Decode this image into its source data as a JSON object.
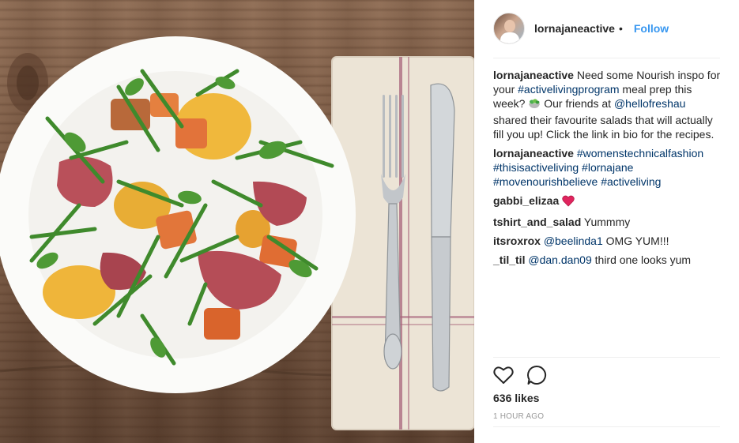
{
  "post": {
    "username": "lornajaneactive",
    "separator": "•",
    "follow_label": "Follow",
    "caption": {
      "username": "lornajaneactive",
      "text1": "Need some Nourish inspo for your",
      "hashtag": "#activelivingprogram",
      "text2": "meal prep this week?",
      "emoji_icon": "salad-bowl-emoji",
      "text3": "Our friends at",
      "mention": "@hellofreshau",
      "text4": "shared their favourite salads that will actually fill you up! Click the link in bio for the recipes."
    },
    "comments": [
      {
        "username": "lornajaneactive",
        "link_text": "#womenstechnicalfashion #thisisactiveliving #lornajane #movenourishbelieve #activeliving",
        "text": ""
      },
      {
        "username": "gabbi_elizaa",
        "link_text": "",
        "text": "",
        "icon": "heart-emoji",
        "icon_color": "#e0245e"
      },
      {
        "username": "tshirt_and_salad",
        "link_text": "",
        "text": "Yummmy"
      },
      {
        "username": "itsroxrox",
        "link_text": "@beelinda1",
        "text": "OMG YUM!!!"
      },
      {
        "username": "_til_til",
        "link_text": "@dan.dan09",
        "text": "third one looks yum"
      }
    ],
    "actions": {
      "like_icon": "heart-outline-icon",
      "comment_icon": "comment-bubble-icon"
    },
    "likes": "636 likes",
    "timestamp": "1 HOUR AGO",
    "colors": {
      "accent": "#3897f0",
      "link": "#003569",
      "text": "#262626",
      "muted": "#999999"
    }
  },
  "image": {
    "subject": "plate-of-salad-with-steak-sweet-potato-corn-arugula",
    "props": [
      "fork",
      "knife",
      "linen-napkin",
      "wooden-table"
    ]
  }
}
